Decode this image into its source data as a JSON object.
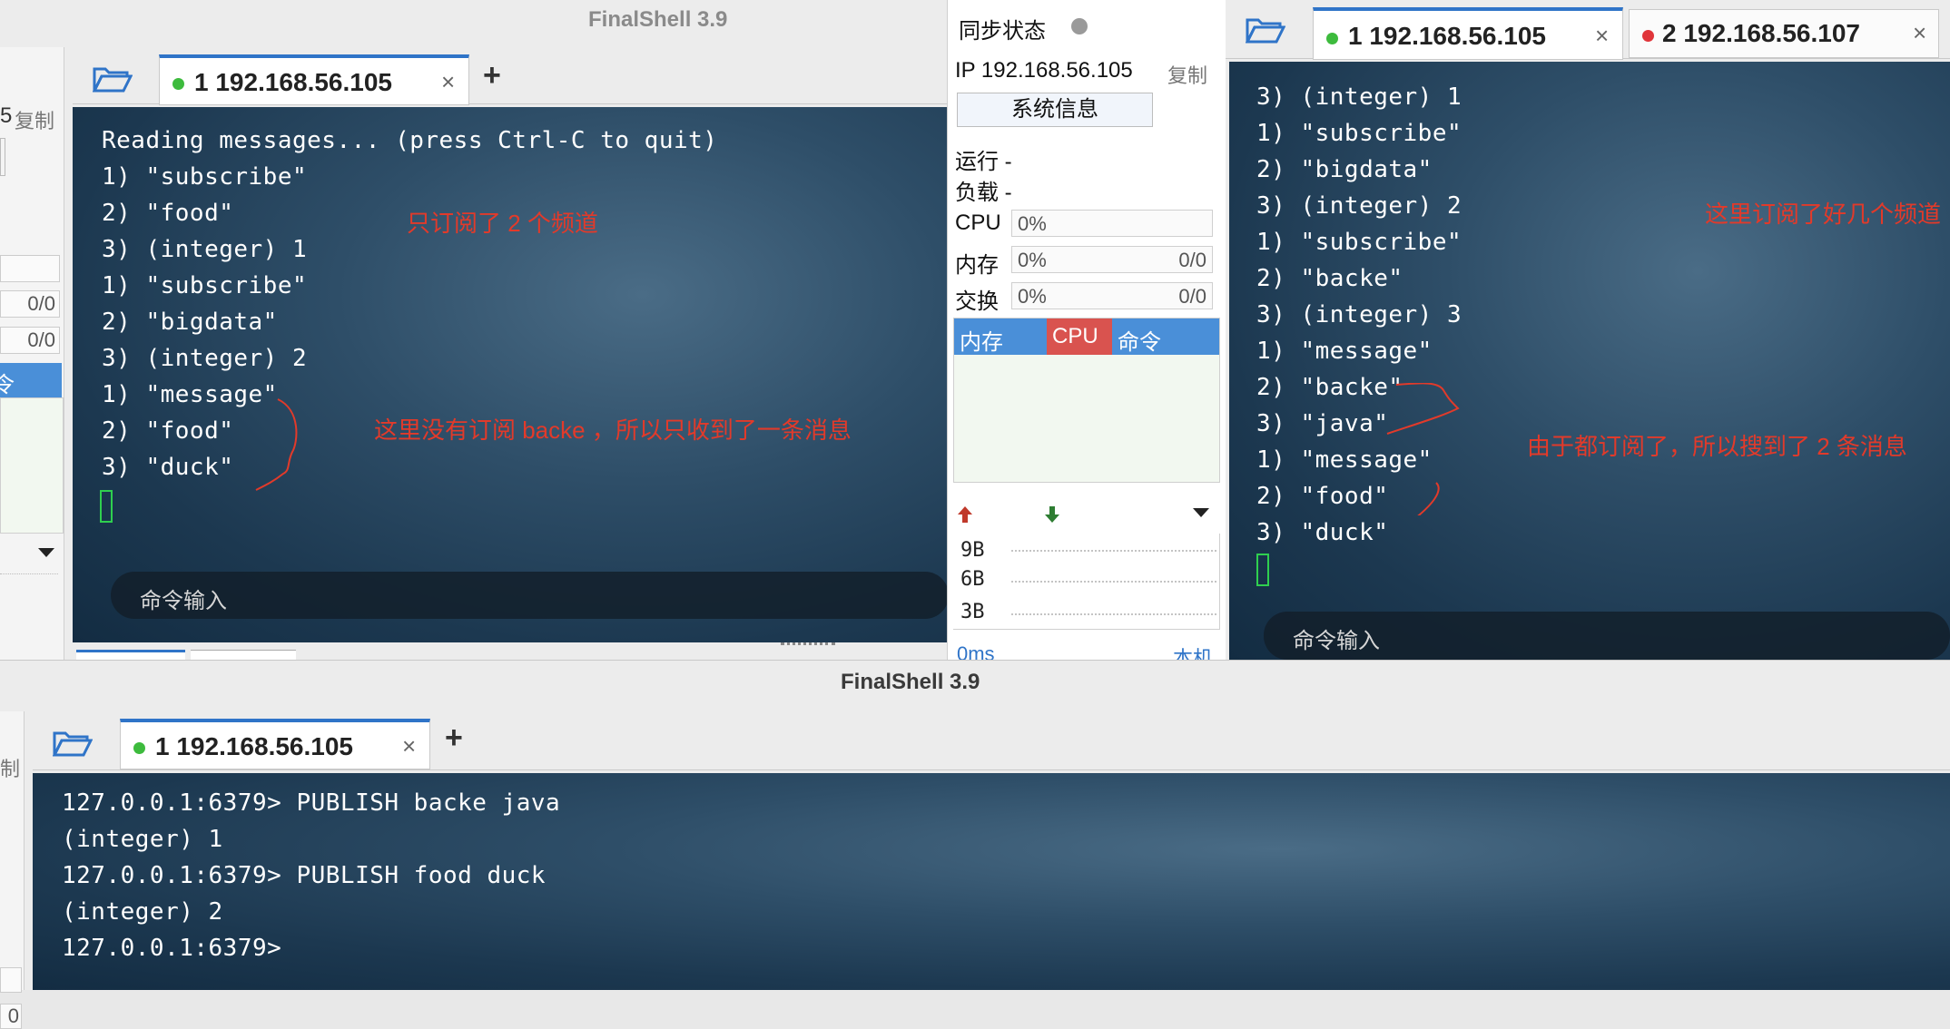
{
  "window1": {
    "title": "FinalShell 3.9",
    "sidebar": {
      "copy_label": "复制",
      "fragment": "5",
      "mem_value": "0/0",
      "swap_value": "0/0",
      "cmd_fragment": "令"
    },
    "tab": {
      "label": "1 192.168.56.105",
      "status_color": "#3dbb3d"
    },
    "terminal_lines": [
      "Reading messages... (press Ctrl-C to quit)",
      "1) \"subscribe\"",
      "2) \"food\"",
      "3) (integer) 1",
      "1) \"subscribe\"",
      "2) \"bigdata\"",
      "3) (integer) 2",
      "1) \"message\"",
      "2) \"food\"",
      "3) \"duck\""
    ],
    "annotations": {
      "note1": "只订阅了 2 个频道",
      "note2": "这里没有订阅 backe ，所以只收到了一条消息"
    },
    "command_input_placeholder": "命令输入"
  },
  "status_panel": {
    "sync_label": "同步状态",
    "ip_label": "IP 192.168.56.105",
    "copy_label": "复制",
    "sysinfo_button": "系统信息",
    "running_label": "运行 -",
    "load_label": "负载 -",
    "cpu_label": "CPU",
    "cpu_value": "0%",
    "mem_label": "内存",
    "mem_value": "0%",
    "mem_ratio": "0/0",
    "swap_label": "交换",
    "swap_value": "0%",
    "swap_ratio": "0/0",
    "table_headers": {
      "mem": "内存",
      "cpu": "CPU",
      "cmd": "命令"
    },
    "net_scale": [
      "9B",
      "6B",
      "3B"
    ],
    "latency_label": "0ms",
    "host_label": "本机"
  },
  "window2": {
    "tabs": [
      {
        "label": "1 192.168.56.105",
        "status_color": "#3dbb3d"
      },
      {
        "label": "2 192.168.56.107",
        "status_color": "#e0353a"
      }
    ],
    "terminal_lines": [
      "3) (integer) 1",
      "1) \"subscribe\"",
      "2) \"bigdata\"",
      "3) (integer) 2",
      "1) \"subscribe\"",
      "2) \"backe\"",
      "3) (integer) 3",
      "1) \"message\"",
      "2) \"backe\"",
      "3) \"java\"",
      "1) \"message\"",
      "2) \"food\"",
      "3) \"duck\""
    ],
    "annotations": {
      "note1": "这里订阅了好几个频道",
      "note2": "由于都订阅了，所以搜到了 2 条消息"
    },
    "command_input_placeholder": "命令输入"
  },
  "window3": {
    "title": "FinalShell 3.9",
    "sidebar": {
      "copy_fragment": "制",
      "value_fragment": "0"
    },
    "tab": {
      "label": "1 192.168.56.105",
      "status_color": "#3dbb3d"
    },
    "terminal_lines": [
      "127.0.0.1:6379> PUBLISH backe java",
      "(integer) 1",
      "127.0.0.1:6379> PUBLISH food duck",
      "(integer) 2",
      "127.0.0.1:6379>"
    ]
  },
  "colors": {
    "annotation_red": "#e23a2a",
    "tab_accent": "#2f74c8",
    "cpu_header_red": "#d9534f",
    "header_blue": "#4a8fd8",
    "cursor_green": "#2fcf4f"
  }
}
